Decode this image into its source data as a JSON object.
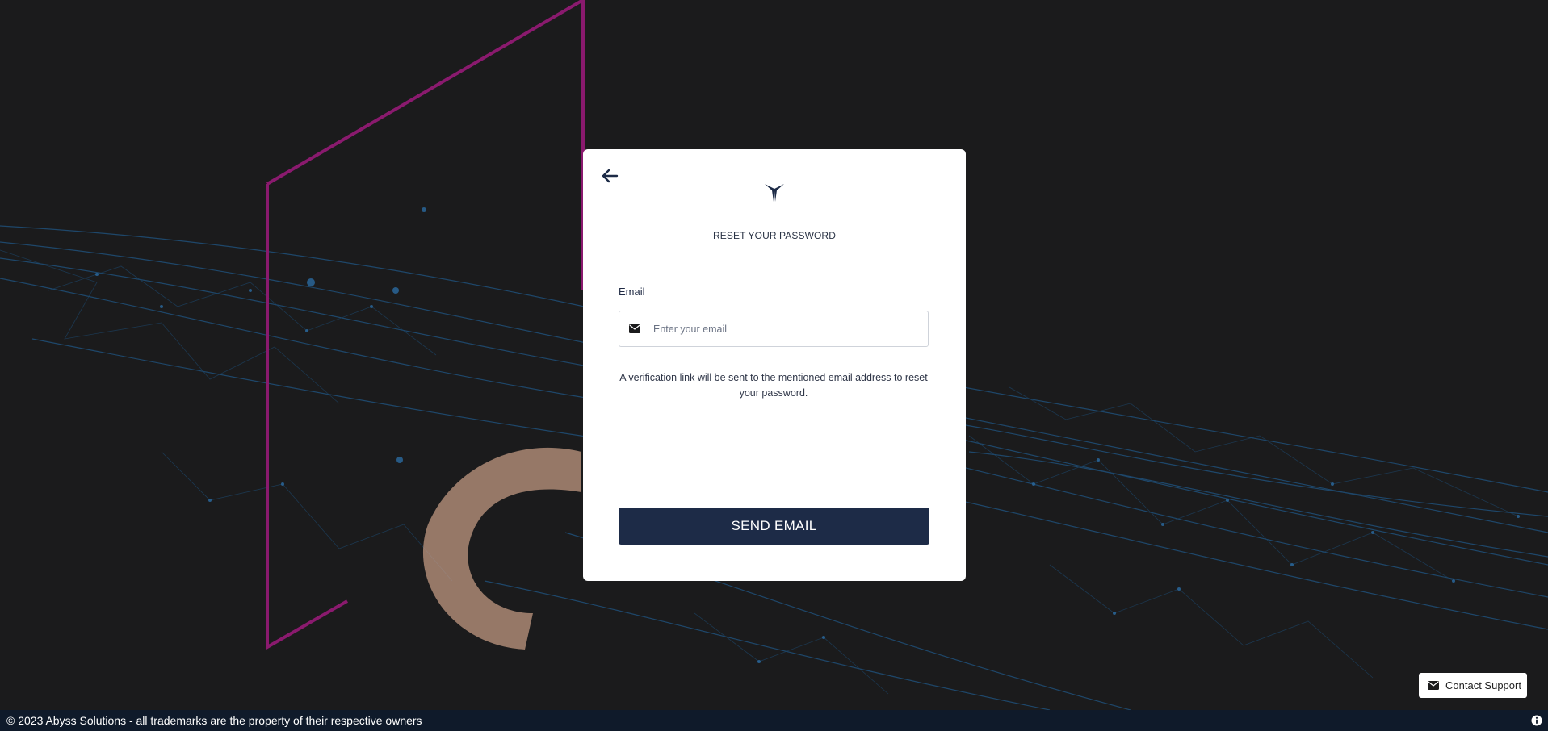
{
  "reset_card": {
    "back_icon": "arrow-left-icon",
    "logo_icon": "brand-logo-icon",
    "title": "RESET YOUR PASSWORD",
    "email_label": "Email",
    "email_icon": "envelope-icon",
    "email_placeholder": "Enter your email",
    "email_value": "",
    "hint": "A verification link will be sent to the mentioned email address to reset your password.",
    "send_button_label": "SEND EMAIL"
  },
  "support": {
    "icon": "envelope-icon",
    "label": "Contact Support"
  },
  "footer": {
    "copyright": "© 2023 Abyss Solutions - all trademarks are the property of their respective owners",
    "info_icon": "info-icon"
  },
  "colors": {
    "background": "#1b1b1c",
    "primary_button": "#1d2b47",
    "footer_bar": "#0f1a2a",
    "accent_frame": "#8a1a6e",
    "network_lines": "#1f4f78"
  }
}
